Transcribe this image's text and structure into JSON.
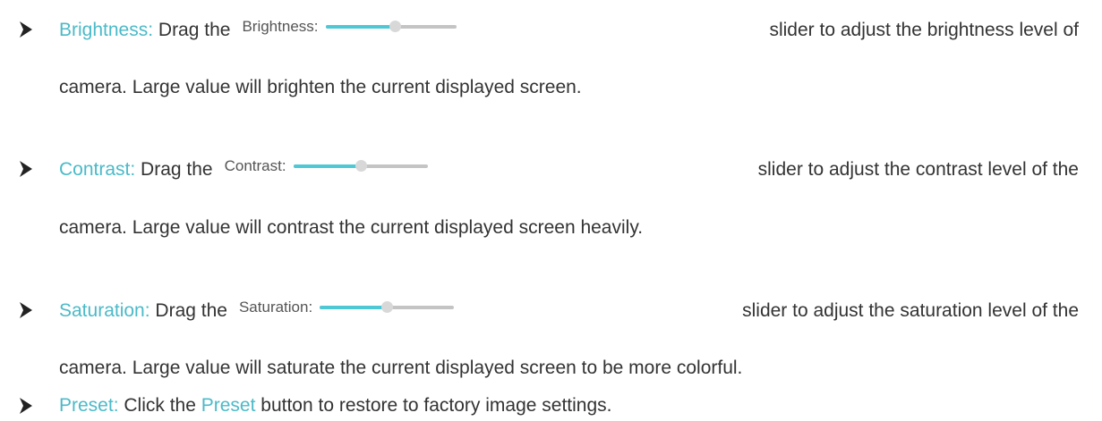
{
  "items": [
    {
      "term": "Brightness:",
      "text_before_widget": " Drag the",
      "widget": {
        "label": "Brightness:",
        "value_fraction": 0.53
      },
      "text_after_widget": "slider to adjust the brightness level of",
      "line2": "camera. Large value will brighten the current displayed screen."
    },
    {
      "term": "Contrast:",
      "text_before_widget": " Drag the",
      "widget": {
        "label": "Contrast:",
        "value_fraction": 0.5
      },
      "text_after_widget": "slider to adjust the contrast level of the",
      "line2": "camera. Large value will contrast the current displayed screen heavily."
    },
    {
      "term": "Saturation:",
      "text_before_widget": " Drag the",
      "widget": {
        "label": "Saturation:",
        "value_fraction": 0.5
      },
      "text_after_widget": "slider to adjust the saturation level of the",
      "line2": "camera. Large value will saturate the current displayed screen to be more colorful."
    },
    {
      "term": "Preset:",
      "text_before": " Click the ",
      "inline_term": "Preset",
      "text_after": " button to restore to factory image settings."
    }
  ],
  "icons": {
    "bullet": "arrow-bullet-icon"
  },
  "colors": {
    "accent": "#4bbac8",
    "slider_fill": "#4fc8d6",
    "slider_track": "#c4c4c4",
    "slider_thumb": "#d8d8d8",
    "body_text": "#333333"
  }
}
